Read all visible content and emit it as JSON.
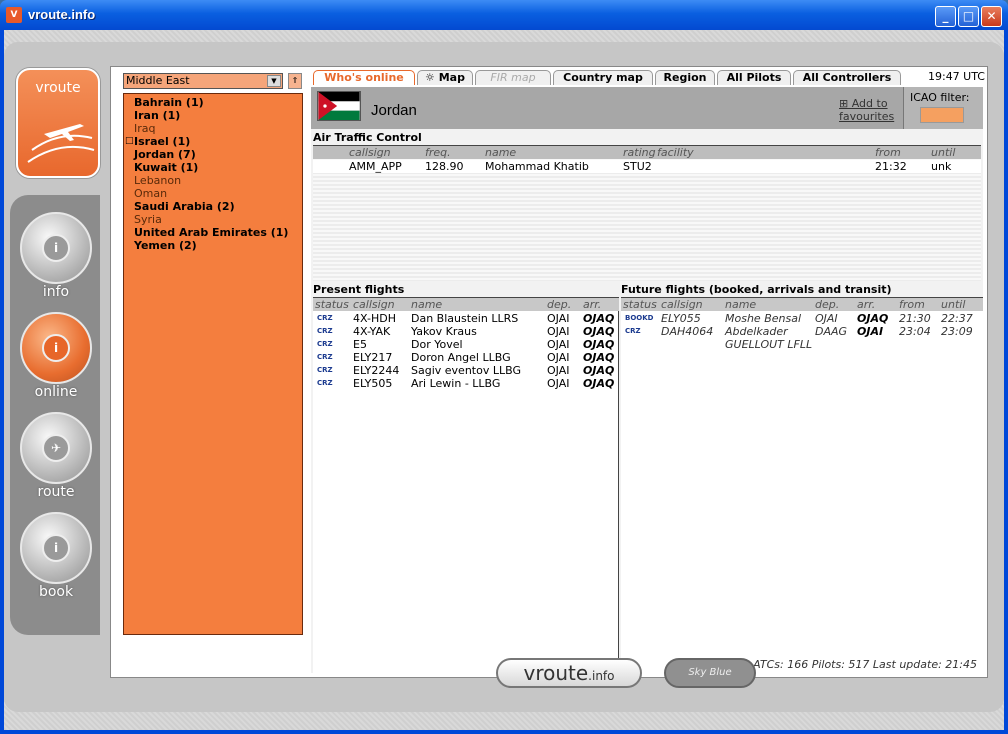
{
  "window": {
    "title": "vroute.info",
    "icon_text": "V",
    "minimize": "_",
    "maximize": "□",
    "close": "✕"
  },
  "logo": {
    "text": "vroute"
  },
  "nav": [
    {
      "label": "info",
      "icon": "i"
    },
    {
      "label": "online",
      "icon": "i"
    },
    {
      "label": "route",
      "icon": "✈"
    },
    {
      "label": "book",
      "icon": "i"
    }
  ],
  "region": {
    "selected": "Middle East",
    "dropdown_arrow": "▼",
    "collapse_symbol": "⇑",
    "countries": [
      {
        "name": "Bahrain (1)",
        "style": "bold"
      },
      {
        "name": "Iran (1)",
        "style": "bold"
      },
      {
        "name": "Iraq",
        "style": "light"
      },
      {
        "name": "Israel (1)",
        "style": "bold"
      },
      {
        "name": "Jordan (7)",
        "style": "bold"
      },
      {
        "name": "Kuwait (1)",
        "style": "bold"
      },
      {
        "name": "Lebanon",
        "style": "light"
      },
      {
        "name": "Oman",
        "style": "light"
      },
      {
        "name": "Saudi Arabia (2)",
        "style": "bold"
      },
      {
        "name": "Syria",
        "style": "light"
      },
      {
        "name": "United Arab Emirates (1)",
        "style": "bold"
      },
      {
        "name": "Yemen (2)",
        "style": "bold"
      }
    ]
  },
  "tabs": [
    {
      "label": "Who's online",
      "state": "active"
    },
    {
      "label": "☼ Map",
      "state": "normal"
    },
    {
      "label": "FIR map",
      "state": "disabled"
    },
    {
      "label": "Country map",
      "state": "normal"
    },
    {
      "label": "Region",
      "state": "normal"
    },
    {
      "label": "All Pilots",
      "state": "normal"
    },
    {
      "label": "All Controllers",
      "state": "normal"
    }
  ],
  "clock": "19:47 UTC",
  "country": {
    "name": "Jordan",
    "add_favourites_line1": "⊞ Add to",
    "add_favourites_line2": "favourites",
    "icao_filter_label": "ICAO filter:",
    "icao_filter_value": "",
    "flag_colors": {
      "black": "#000000",
      "white": "#ffffff",
      "green": "#007a3d",
      "red": "#ce1126"
    }
  },
  "atc": {
    "title": "Air Traffic Control",
    "headers": [
      "callsign",
      "freq.",
      "name",
      "rating",
      "facility",
      "from",
      "until"
    ],
    "rows": [
      {
        "callsign": "AMM_APP",
        "freq": "128.90",
        "name": "Mohammad Khatib",
        "rating": "STU2",
        "facility": "",
        "from": "21:32",
        "until": "unk"
      }
    ]
  },
  "present": {
    "title": "Present flights",
    "headers": [
      "status",
      "callsign",
      "name",
      "dep.",
      "arr."
    ],
    "rows": [
      {
        "status": "CRZ",
        "callsign": "4X-HDH",
        "name": "Dan Blaustein LLRS",
        "dep": "OJAI",
        "arr": "OJAQ"
      },
      {
        "status": "CRZ",
        "callsign": "4X-YAK",
        "name": "Yakov Kraus",
        "dep": "OJAI",
        "arr": "OJAQ"
      },
      {
        "status": "CRZ",
        "callsign": "E5",
        "name": "Dor Yovel",
        "dep": "OJAI",
        "arr": "OJAQ"
      },
      {
        "status": "CRZ",
        "callsign": "ELY217",
        "name": "Doron Angel LLBG",
        "dep": "OJAI",
        "arr": "OJAQ"
      },
      {
        "status": "CRZ",
        "callsign": "ELY2244",
        "name": "Sagiv eventov LLBG",
        "dep": "OJAI",
        "arr": "OJAQ"
      },
      {
        "status": "CRZ",
        "callsign": "ELY505",
        "name": "Ari Lewin - LLBG",
        "dep": "OJAI",
        "arr": "OJAQ"
      }
    ]
  },
  "future": {
    "title": "Future flights (booked, arrivals and transit)",
    "headers": [
      "status",
      "callsign",
      "name",
      "dep.",
      "arr.",
      "from",
      "until"
    ],
    "rows": [
      {
        "status": "BOOKD",
        "callsign": "ELY055",
        "name": "Moshe Bensal",
        "dep": "OJAI",
        "arr": "OJAQ",
        "from": "21:30",
        "until": "22:37"
      },
      {
        "status": "CRZ",
        "callsign": "DAH4064",
        "name": "Abdelkader",
        "name2": "GUELLOUT LFLL",
        "dep": "DAAG",
        "arr": "OJAI",
        "from": "23:04",
        "until": "23:09"
      }
    ]
  },
  "footer": "VATSIM online ATCs: 166 Pilots: 517 Last update: 21:45",
  "bottom": {
    "logo_main": "vroute",
    "logo_suffix": ".info",
    "skyblue": "Sky Blue"
  }
}
